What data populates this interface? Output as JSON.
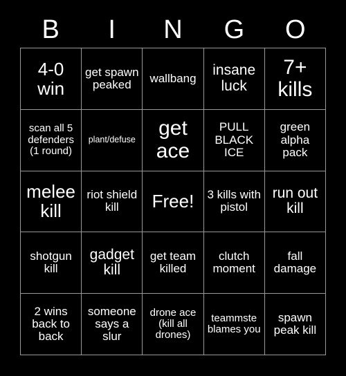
{
  "card": {
    "background_color": "#000000",
    "text_color": "#ffffff",
    "border_color": "#9a9a9a",
    "title_letters": [
      "B",
      "I",
      "N",
      "G",
      "O"
    ]
  },
  "grid": {
    "columns": 5,
    "rows": 5,
    "free_space_index": 12,
    "cells": [
      {
        "text": "4-0 win",
        "size": "xl"
      },
      {
        "text": "get spawn peaked",
        "size": "m"
      },
      {
        "text": "wallbang",
        "size": "m"
      },
      {
        "text": "insane luck",
        "size": "l"
      },
      {
        "text": "7+ kills",
        "size": "xxl"
      },
      {
        "text": "scan all 5 defenders (1 round)",
        "size": "s"
      },
      {
        "text": "plant/defuse",
        "size": "xs"
      },
      {
        "text": "get ace",
        "size": "xxl"
      },
      {
        "text": "PULL BLACK ICE",
        "size": "m"
      },
      {
        "text": "green alpha pack",
        "size": "m"
      },
      {
        "text": "melee kill",
        "size": "xl"
      },
      {
        "text": "riot shield kill",
        "size": "m"
      },
      {
        "text": "Free!",
        "size": "xl"
      },
      {
        "text": "3 kills with pistol",
        "size": "m"
      },
      {
        "text": "run out kill",
        "size": "l"
      },
      {
        "text": "shotgun kill",
        "size": "m"
      },
      {
        "text": "gadget kill",
        "size": "l"
      },
      {
        "text": "get team killed",
        "size": "m"
      },
      {
        "text": "clutch moment",
        "size": "m"
      },
      {
        "text": "fall damage",
        "size": "m"
      },
      {
        "text": "2 wins back to back",
        "size": "m"
      },
      {
        "text": "someone says a slur",
        "size": "m"
      },
      {
        "text": "drone ace (kill all drones)",
        "size": "s"
      },
      {
        "text": "teammste blames you",
        "size": "s"
      },
      {
        "text": "spawn peak kill",
        "size": "m"
      }
    ]
  }
}
